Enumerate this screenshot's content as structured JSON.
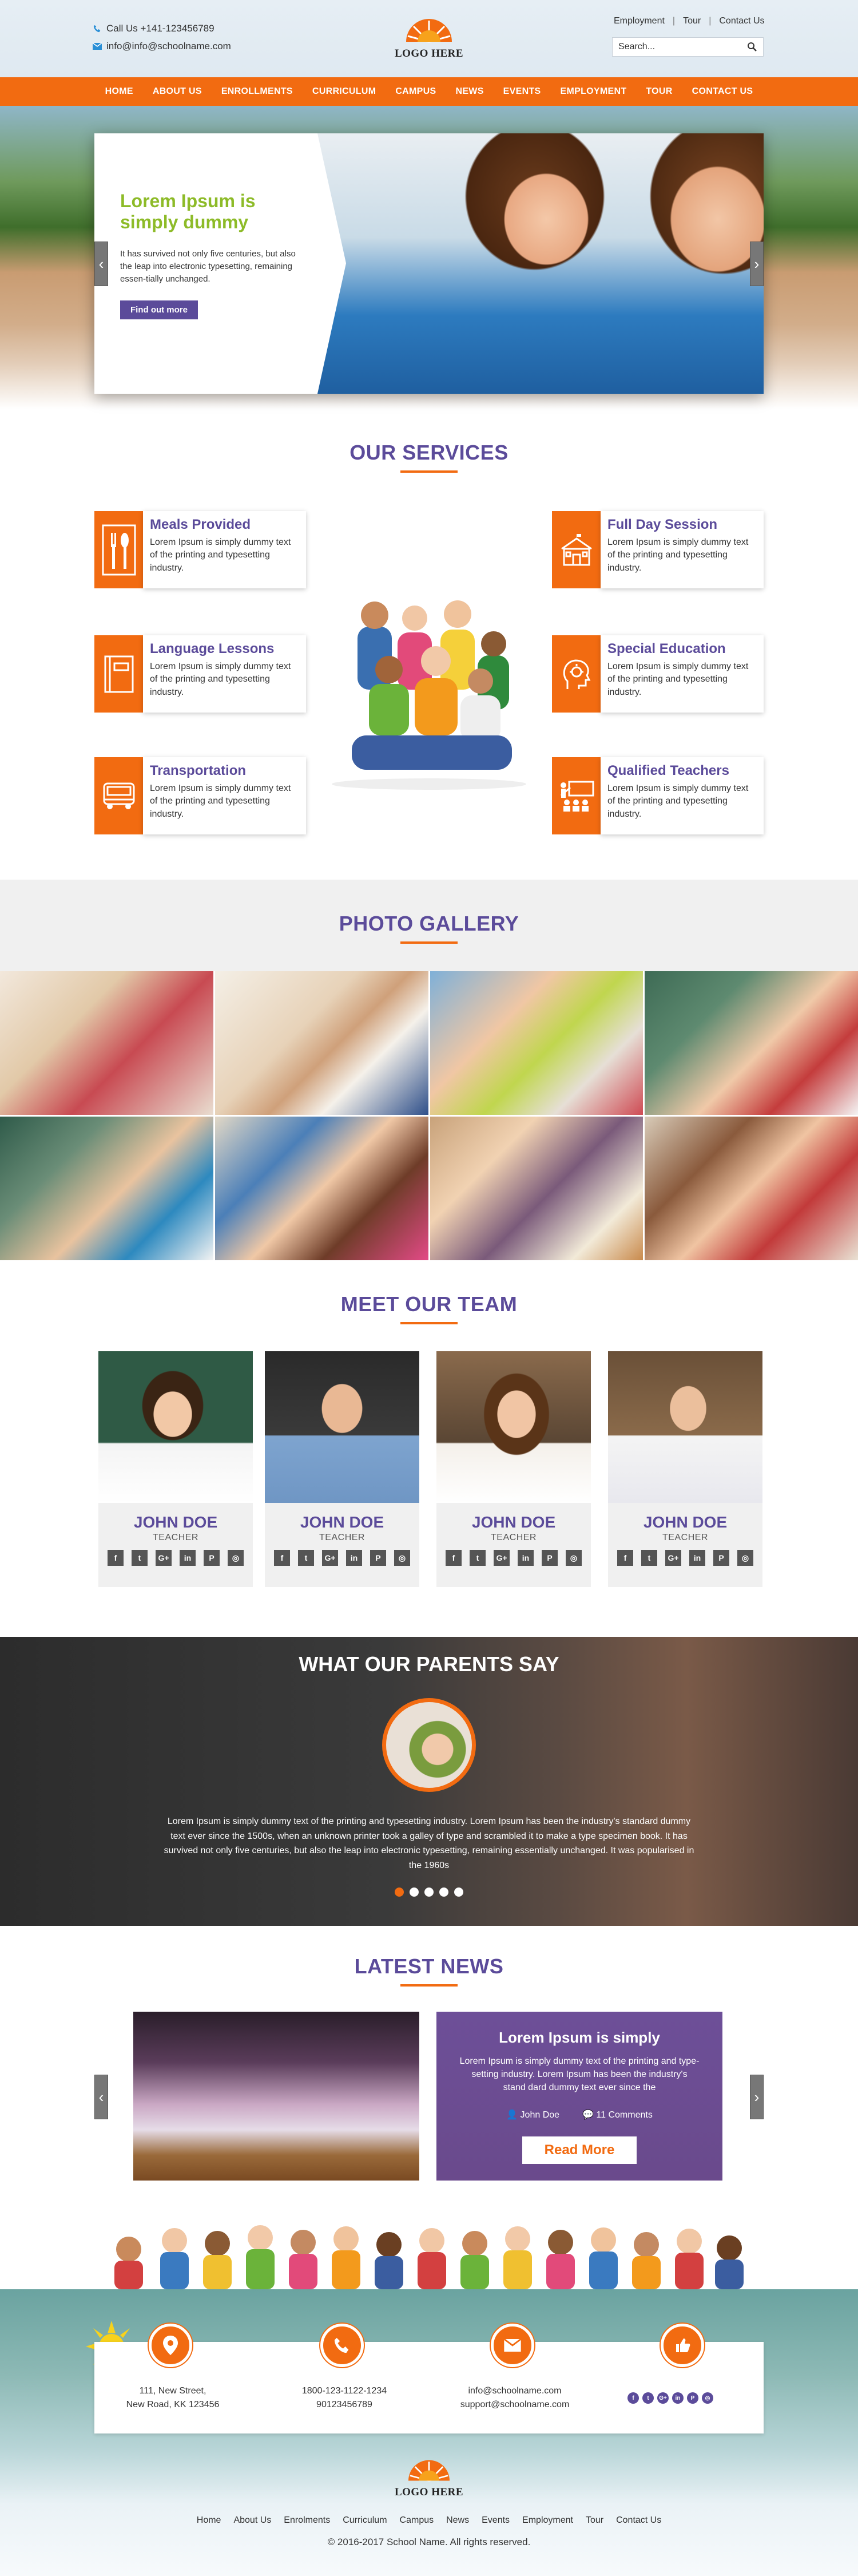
{
  "header": {
    "phone": "Call Us +141-123456789",
    "email": "info@info@schoolname.com",
    "logo_text": "LOGO HERE",
    "top_links": [
      "Employment",
      "Tour",
      "Contact Us"
    ],
    "search_placeholder": "Search..."
  },
  "nav": [
    "HOME",
    "ABOUT US",
    "ENROLLMENTS",
    "CURRICULUM",
    "CAMPUS",
    "NEWS",
    "EVENTS",
    "EMPLOYMENT",
    "TOUR",
    "CONTACT US"
  ],
  "hero": {
    "title": "Lorem Ipsum is simply dummy",
    "description": "It has survived not only five centuries, but also the leap into electronic typesetting, remaining essen-tially unchanged.",
    "button": "Find out more"
  },
  "services": {
    "title": "OUR SERVICES",
    "items": [
      {
        "title": "Meals Provided",
        "desc": "Lorem Ipsum is simply dummy text of the printing and typesetting industry.",
        "icon": "meals-icon"
      },
      {
        "title": "Full Day Session",
        "desc": "Lorem Ipsum is simply dummy text of the printing and typesetting industry.",
        "icon": "school-building-icon"
      },
      {
        "title": "Language Lessons",
        "desc": "Lorem Ipsum is simply dummy text of the printing and typesetting industry.",
        "icon": "book-icon"
      },
      {
        "title": "Special Education",
        "desc": "Lorem Ipsum is simply dummy text of the printing and typesetting industry.",
        "icon": "head-idea-icon"
      },
      {
        "title": "Transportation",
        "desc": "Lorem Ipsum is simply dummy text of the printing and typesetting industry.",
        "icon": "bus-icon"
      },
      {
        "title": "Qualified Teachers",
        "desc": "Lorem Ipsum is simply dummy text of the printing and typesetting industry.",
        "icon": "classroom-icon"
      }
    ]
  },
  "gallery": {
    "title": "PHOTO GALLERY"
  },
  "team": {
    "title": "MEET OUR TEAM",
    "members": [
      {
        "name": "JOHN DOE",
        "role": "TEACHER"
      },
      {
        "name": "JOHN DOE",
        "role": "TEACHER"
      },
      {
        "name": "JOHN DOE",
        "role": "TEACHER"
      },
      {
        "name": "JOHN DOE",
        "role": "TEACHER"
      }
    ],
    "social": [
      "f",
      "t",
      "G+",
      "in",
      "P",
      "◎"
    ]
  },
  "testimonials": {
    "title": "WHAT OUR PARENTS SAY",
    "text": "Lorem Ipsum is simply dummy text of the printing and typesetting industry. Lorem Ipsum has been the industry's standard dummy text ever since the 1500s, when an unknown printer took a galley of type and scrambled it to make a type specimen book. It has survived not only five centuries, but also the leap into electronic typesetting, remaining essentially unchanged. It was popularised in the 1960s",
    "dots": 5,
    "active_dot": 1
  },
  "news": {
    "title": "LATEST NEWS",
    "card_title": "Lorem Ipsum is simply",
    "card_desc": "Lorem Ipsum is simply dummy text of the printing and type-setting industry. Lorem Ipsum has been the industry's stand dard dummy text ever since the",
    "author": "John Doe",
    "comments": "11 Comments",
    "button": "Read More"
  },
  "footer": {
    "address": [
      "111, New Street,",
      "New Road, KK 123456"
    ],
    "phones": [
      "1800-123-1122-1234",
      "90123456789"
    ],
    "emails": [
      "info@schoolname.com",
      "support@schoolname.com"
    ],
    "social": [
      "f",
      "t",
      "G+",
      "in",
      "P",
      "◎"
    ],
    "logo_text": "LOGO HERE",
    "nav": [
      "Home",
      "About Us",
      "Enrolments",
      "Curriculum",
      "Campus",
      "News",
      "Events",
      "Employment",
      "Tour",
      "Contact Us"
    ],
    "copyright": "© 2016-2017 School Name. All rights reserved."
  },
  "colors": {
    "accent": "#f26b11",
    "primary": "#5b4b9a",
    "hero_title": "#8dbb28"
  }
}
